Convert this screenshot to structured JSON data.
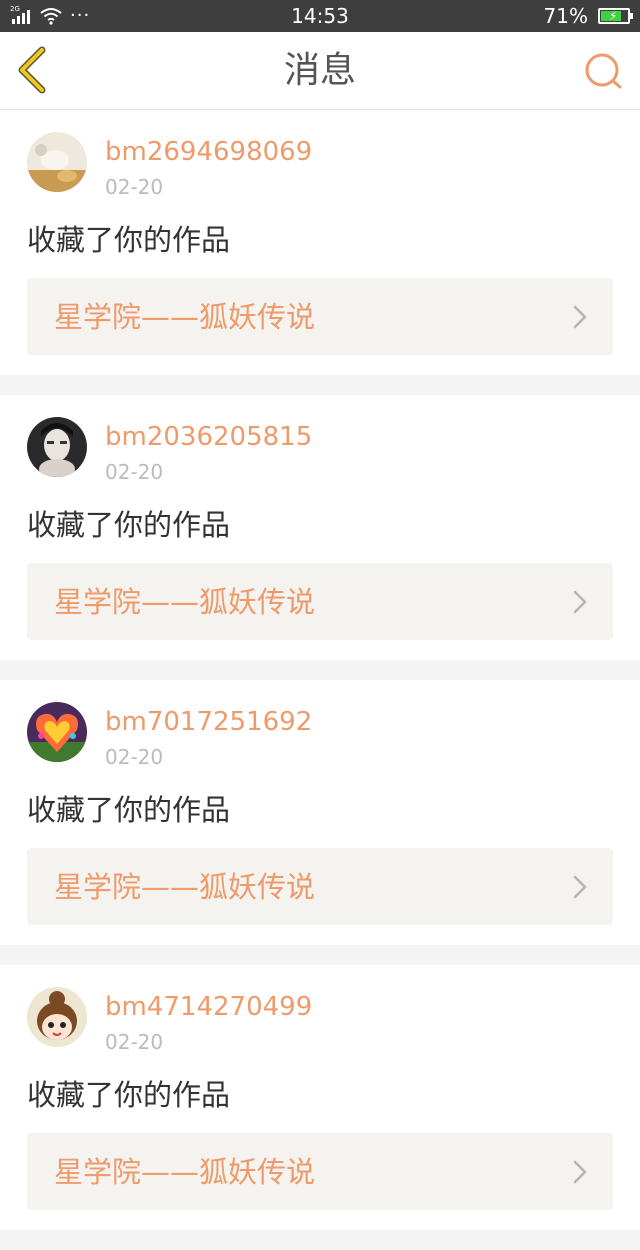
{
  "status_bar": {
    "network": "2G",
    "dots": "···",
    "time": "14:53",
    "battery": "71%",
    "battery_level": 0.71,
    "battery_fill_color": "#3fd23f"
  },
  "header": {
    "title": "消息",
    "back_icon": "chevron-left-icon",
    "back_icon_color": "#f2c81a",
    "search_icon": "search-icon",
    "search_icon_color": "#ee9a6a"
  },
  "colors": {
    "accent": "#ee9a6a",
    "action_text": "#333333",
    "date_text": "#bbbbbb",
    "work_bg": "#f4f3ef",
    "page_bg": "#f4f4f4"
  },
  "messages": [
    {
      "username": "bm2694698069",
      "date": "02-20",
      "action": "收藏了你的作品",
      "work_title": "星学院——狐妖传说",
      "avatar": "avatar-photo-light"
    },
    {
      "username": "bm2036205815",
      "date": "02-20",
      "action": "收藏了你的作品",
      "work_title": "星学院——狐妖传说",
      "avatar": "avatar-photo-portrait"
    },
    {
      "username": "bm7017251692",
      "date": "02-20",
      "action": "收藏了你的作品",
      "work_title": "星学院——狐妖传说",
      "avatar": "avatar-photo-heart"
    },
    {
      "username": "bm4714270499",
      "date": "02-20",
      "action": "收藏了你的作品",
      "work_title": "星学院——狐妖传说",
      "avatar": "avatar-cartoon-girl"
    }
  ]
}
